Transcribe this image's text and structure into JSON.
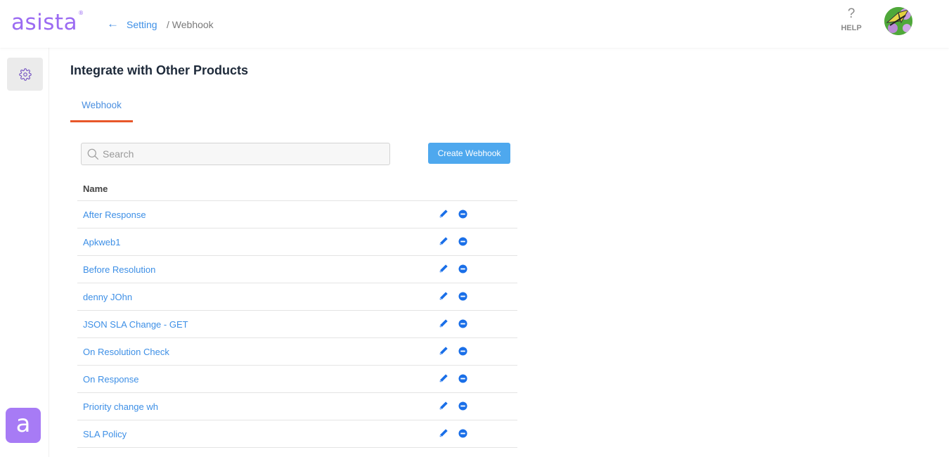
{
  "header": {
    "logo": "asista",
    "logo_mark": "®",
    "breadcrumb": {
      "back_icon": "arrow-left-icon",
      "parent": "Setting",
      "current": "/ Webhook"
    },
    "help": {
      "icon": "question-icon",
      "label": "HELP"
    },
    "avatar_icon": "butterfly-avatar"
  },
  "sidebar": {
    "items": [
      {
        "icon": "gear-icon",
        "label": "Settings"
      }
    ],
    "app_icon": {
      "glyph": "a"
    }
  },
  "main": {
    "title": "Integrate with Other Products",
    "tabs": [
      {
        "label": "Webhook",
        "active": true
      }
    ],
    "search": {
      "placeholder": "Search",
      "value": ""
    },
    "create_button": "Create Webhook",
    "table": {
      "columns": [
        "Name"
      ],
      "rows": [
        {
          "name": "After Response"
        },
        {
          "name": "Apkweb1"
        },
        {
          "name": "Before Resolution"
        },
        {
          "name": "denny JOhn"
        },
        {
          "name": "JSON SLA Change - GET"
        },
        {
          "name": "On Resolution Check"
        },
        {
          "name": "On Response"
        },
        {
          "name": "Priority change wh"
        },
        {
          "name": "SLA Policy"
        }
      ]
    }
  },
  "colors": {
    "brand": "#9b6bf2",
    "link": "#3d8fe6",
    "tab_underline": "#e8572a",
    "button": "#4ea8ee",
    "action_icon": "#1a6fe8"
  }
}
